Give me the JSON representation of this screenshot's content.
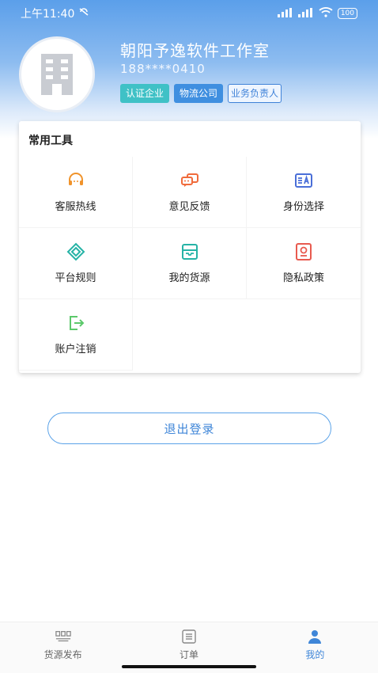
{
  "status_bar": {
    "time": "上午11:40",
    "battery": "100"
  },
  "profile": {
    "company_name": "朝阳予逸软件工作室",
    "phone": "188****0410",
    "tags": [
      "认证企业",
      "物流公司",
      "业务负责人"
    ]
  },
  "tools": {
    "title": "常用工具",
    "items": [
      {
        "label": "客服热线",
        "icon": "headset-icon",
        "color": "#f0932b"
      },
      {
        "label": "意见反馈",
        "icon": "chat-bubbles-icon",
        "color": "#f06b3b"
      },
      {
        "label": "身份选择",
        "icon": "id-card-icon",
        "color": "#4a6fd8"
      },
      {
        "label": "平台规则",
        "icon": "diamond-rules-icon",
        "color": "#26b3a6"
      },
      {
        "label": "我的货源",
        "icon": "cargo-box-icon",
        "color": "#26b3a6"
      },
      {
        "label": "隐私政策",
        "icon": "privacy-shield-icon",
        "color": "#e85a4f"
      },
      {
        "label": "账户注销",
        "icon": "logout-arrow-icon",
        "color": "#5cc96b"
      }
    ]
  },
  "logout_button": "退出登录",
  "tab_bar": {
    "items": [
      {
        "label": "货源发布",
        "icon": "cargo-publish-icon",
        "active": false
      },
      {
        "label": "订单",
        "icon": "order-list-icon",
        "active": false
      },
      {
        "label": "我的",
        "icon": "person-icon",
        "active": true
      }
    ],
    "active_color": "#3f86d8"
  }
}
